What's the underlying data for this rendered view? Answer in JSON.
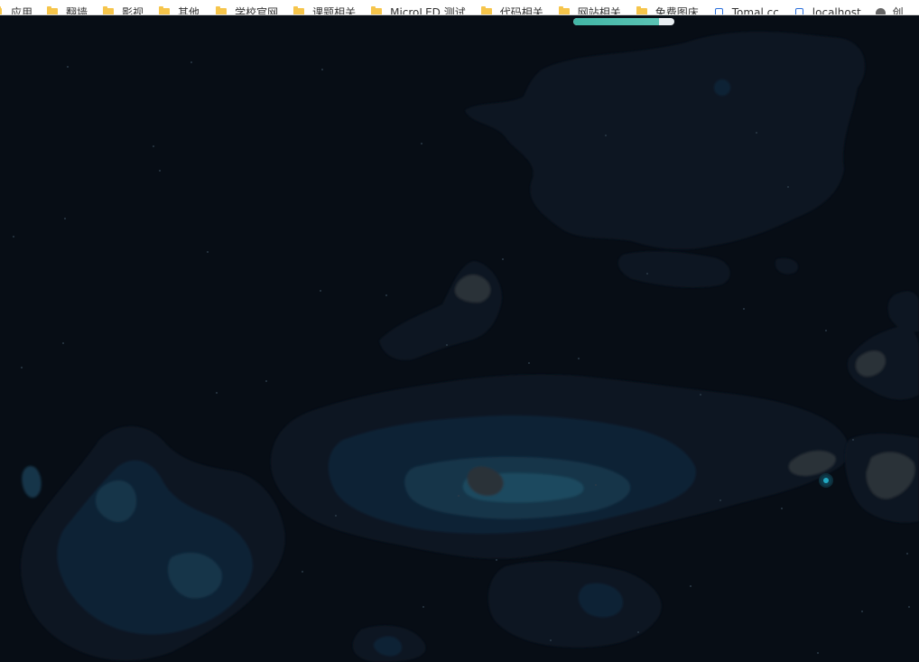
{
  "bookmarks": [
    {
      "label": "应用",
      "icon": "apps-icon"
    },
    {
      "label": "翻墙",
      "icon": "folder-icon"
    },
    {
      "label": "影视",
      "icon": "folder-icon"
    },
    {
      "label": "其他",
      "icon": "folder-icon"
    },
    {
      "label": "学校官网",
      "icon": "folder-icon"
    },
    {
      "label": "课题相关",
      "icon": "folder-icon"
    },
    {
      "label": "MicroLED 测试",
      "icon": "folder-icon"
    },
    {
      "label": "代码相关",
      "icon": "folder-icon"
    },
    {
      "label": "网站相关",
      "icon": "folder-icon"
    },
    {
      "label": "免费图床",
      "icon": "folder-icon"
    },
    {
      "label": "Tomal.cc",
      "icon": "page-icon"
    },
    {
      "label": "localhost",
      "icon": "page-icon"
    },
    {
      "label": "创",
      "icon": "globe-icon"
    }
  ],
  "loading": {
    "progress": 0.85
  },
  "colors": {
    "background": "#070d15",
    "cloud_dark": "#0b1622",
    "cloud_mid": "#0f2436",
    "cloud_light": "#153448",
    "cloud_bright": "#1b4a5f",
    "warm": "#2a3338",
    "progress": "#42b6a6",
    "marker": "#21a8c2"
  }
}
